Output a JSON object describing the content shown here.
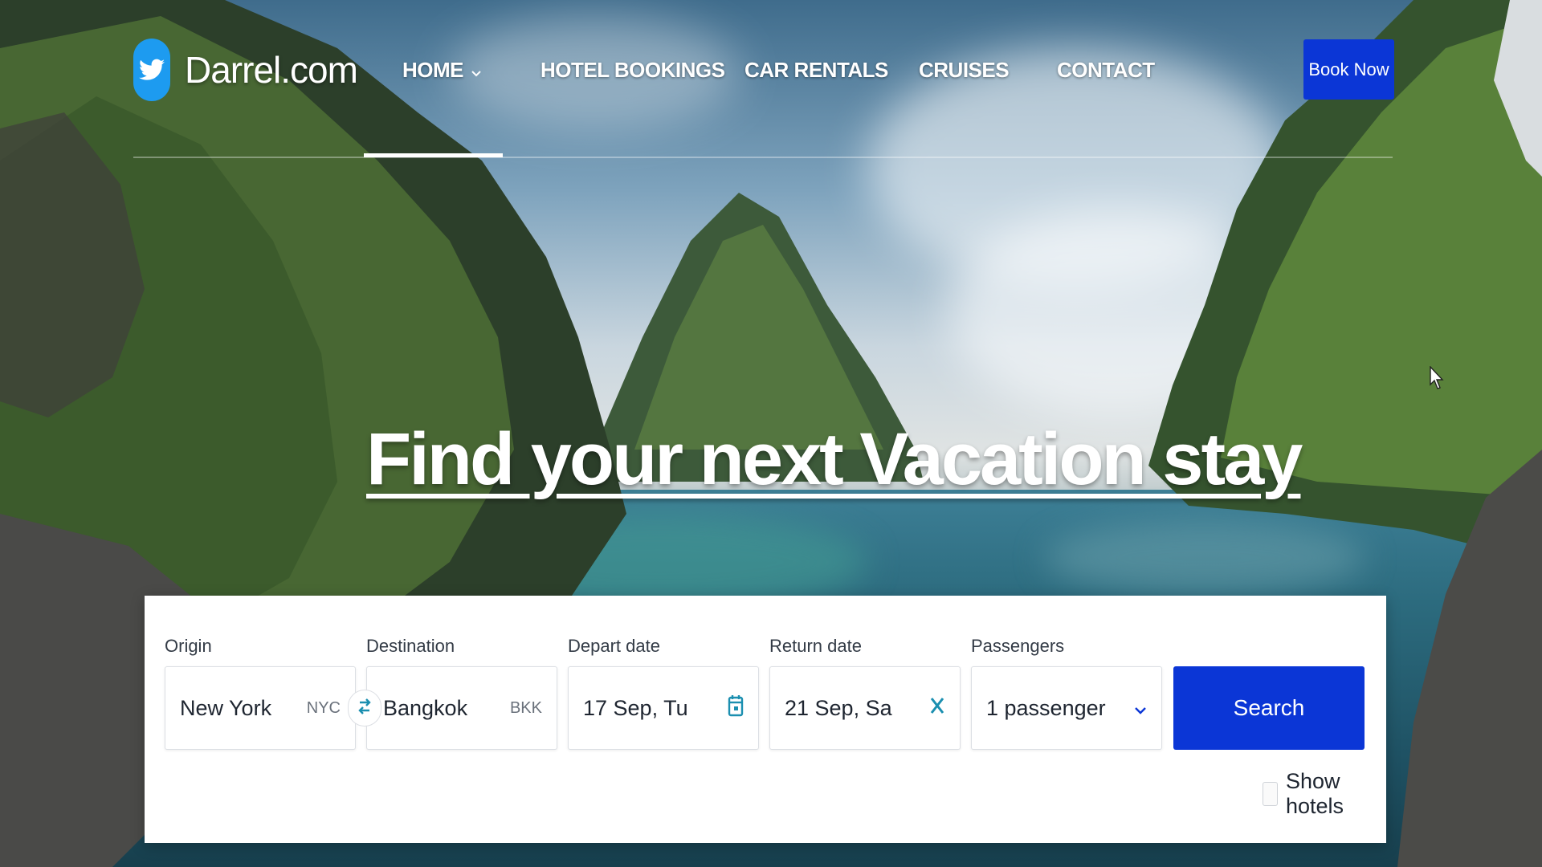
{
  "brand": {
    "name": "Darrel.com",
    "icon": "twitter-bird-icon"
  },
  "nav": {
    "items": [
      {
        "label": "HOME",
        "has_dropdown": true,
        "active": true
      },
      {
        "label": "HOTEL BOOKINGS"
      },
      {
        "label": "CAR RENTALS"
      },
      {
        "label": "CRUISES"
      },
      {
        "label": "CONTACT"
      }
    ],
    "cta_label": "Book Now"
  },
  "hero": {
    "title": "Find your next Vacation stay"
  },
  "search": {
    "origin": {
      "label": "Origin",
      "value": "New York",
      "code": "NYC"
    },
    "destination": {
      "label": "Destination",
      "value": "Bangkok",
      "code": "BKK"
    },
    "depart": {
      "label": "Depart date",
      "value": "17 Sep, Tu"
    },
    "return": {
      "label": "Return date",
      "value": "21 Sep, Sa"
    },
    "passengers": {
      "label": "Passengers",
      "value": "1 passenger"
    },
    "search_label": "Search",
    "show_hotels_label": "Show hotels"
  },
  "colors": {
    "accent": "#0b36d6",
    "brand_icon": "#1d9bf0",
    "icon_teal": "#1b8fb0"
  }
}
